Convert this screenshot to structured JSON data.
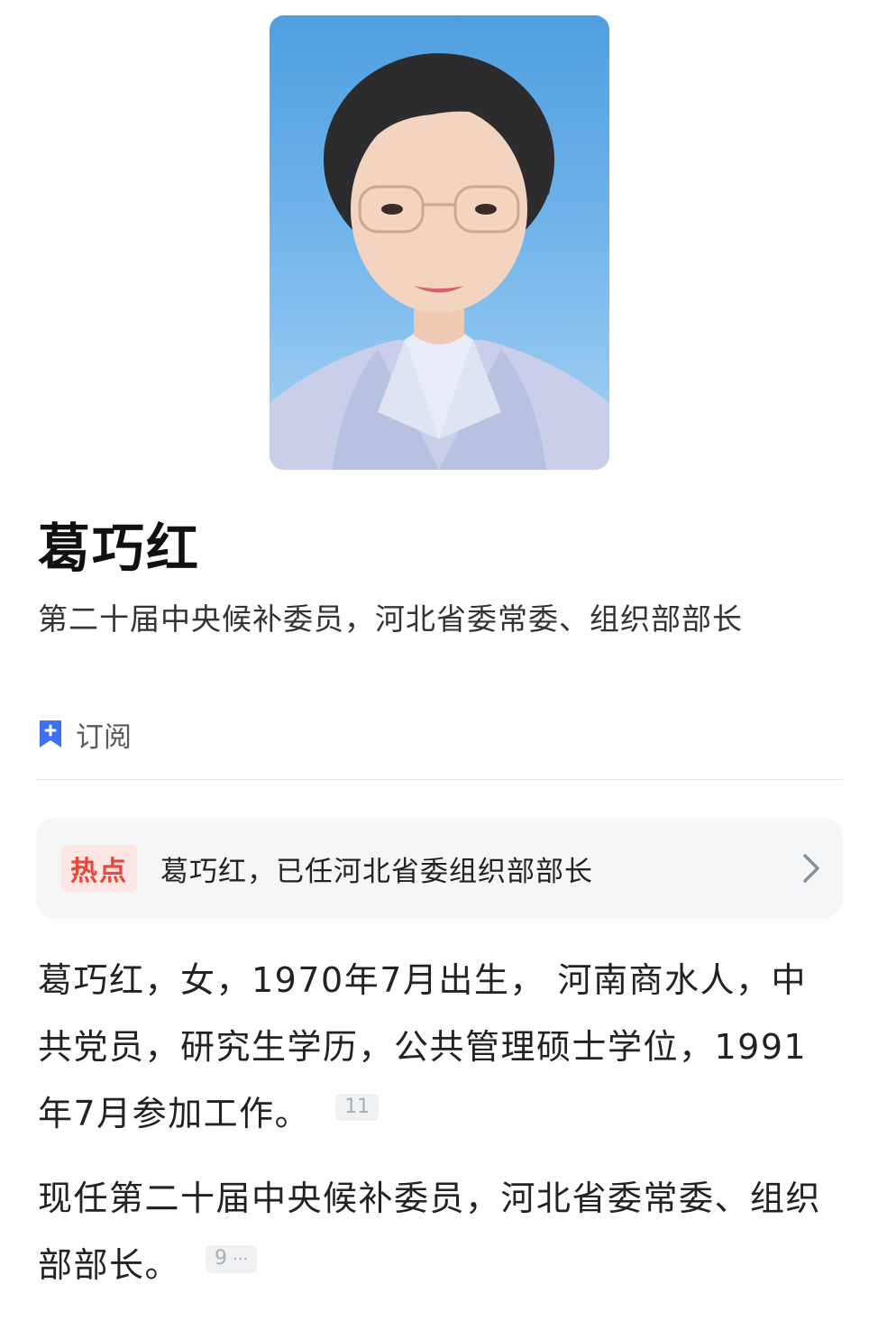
{
  "profile": {
    "name": "葛巧红",
    "subtitle": "第二十届中央候补委员，河北省委常委、组织部部长",
    "subscribe_label": "订阅"
  },
  "hot": {
    "tag": "热点",
    "text": "葛巧红，已任河北省委组织部部长"
  },
  "bio": {
    "p1": "葛巧红，女，1970年7月出生， 河南商水人，中共党员，研究生学历，公共管理硕士学位，1991年7月参加工作。",
    "p1_ref": "11",
    "p2": "现任第二十届中央候补委员，河北省委常委、组织部部长。",
    "p2_ref": "9",
    "p2_ref_more": "···"
  },
  "colors": {
    "accent_blue": "#3d6ff0",
    "hot_red": "#e8473a",
    "hot_bg": "#fde6e4"
  },
  "icons": {
    "subscribe": "bookmark-plus-icon",
    "hot_more": "chevron-right-icon"
  }
}
